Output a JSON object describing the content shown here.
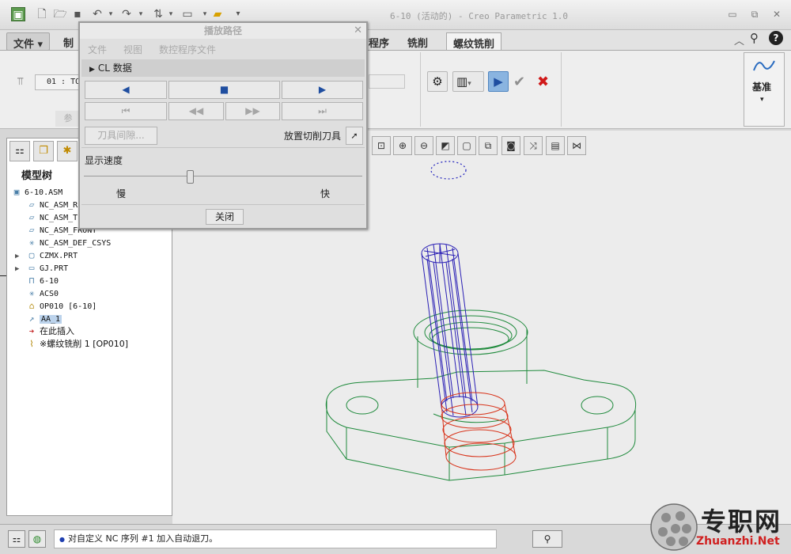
{
  "window": {
    "title": "6-10 (活动的) - Creo Parametric 1.0",
    "minimize": "▭",
    "restore": "⧉",
    "close": "✕"
  },
  "ribbon_tabs": {
    "file": "文件 ▾",
    "tab_partial": "制",
    "program": "程序",
    "milling": "铣削",
    "thread_milling": "螺纹铣削"
  },
  "ribbon": {
    "combo_value": "01 : TO",
    "ref_label": "参",
    "datum_label": "基准",
    "datum_arrow": "▾"
  },
  "left_panel": {
    "tab_icons": [
      "model-tree-icon",
      "layers-icon",
      "favorites-icon"
    ],
    "title": "模型树",
    "tree": [
      {
        "icon": "▣",
        "text": "6-10.ASM",
        "level": 0,
        "icon_name": "assembly-icon",
        "expand": ""
      },
      {
        "icon": "▱",
        "text": "NC_ASM_R",
        "level": 1,
        "icon_name": "datum-plane-icon",
        "expand": ""
      },
      {
        "icon": "▱",
        "text": "NC_ASM_T",
        "level": 1,
        "icon_name": "datum-plane-icon",
        "expand": ""
      },
      {
        "icon": "▱",
        "text": "NC_ASM_FRONT",
        "level": 1,
        "icon_name": "datum-plane-icon",
        "expand": ""
      },
      {
        "icon": "✳",
        "text": "NC_ASM_DEF_CSYS",
        "level": 1,
        "icon_name": "csys-icon",
        "expand": ""
      },
      {
        "icon": "▢",
        "text": "CZMX.PRT",
        "level": 1,
        "icon_name": "part-icon",
        "expand": "▶"
      },
      {
        "icon": "▭",
        "text": "GJ.PRT",
        "level": 1,
        "icon_name": "part-icon",
        "expand": "▶"
      },
      {
        "icon": "⊓",
        "text": "6-10",
        "level": 1,
        "icon_name": "workcell-icon",
        "expand": ""
      },
      {
        "icon": "✳",
        "text": "ACS0",
        "level": 1,
        "icon_name": "csys-icon",
        "expand": ""
      },
      {
        "icon": "⌂",
        "text": "OP010 [6-10]",
        "level": 1,
        "icon_name": "operation-icon",
        "expand": ""
      },
      {
        "icon": "↗",
        "text": "AA_1",
        "level": 1,
        "icon_name": "datum-axis-icon",
        "expand": ""
      },
      {
        "icon": "➔",
        "text": "在此插入",
        "level": 1,
        "icon_name": "insert-here-arrow-icon",
        "expand": ""
      },
      {
        "icon": "⌇",
        "text": "※螺纹铣削 1 [OP010]",
        "level": 1,
        "icon_name": "thread-milling-icon",
        "expand": ""
      }
    ]
  },
  "dialog": {
    "title": "播放路径",
    "close_glyph": "✕",
    "menu": [
      "文件",
      "视图",
      "数控程序文件"
    ],
    "cl_data_label": "CL 数据",
    "cl_expand": "▶",
    "play_buttons": {
      "rewind": "◀",
      "stop": "■",
      "play": "▶",
      "first": "⏮",
      "back": "◀◀",
      "forward": "▶▶",
      "last": "⏭"
    },
    "tool_clearance": "刀具间隙...",
    "place_cutter": "放置切削刀具",
    "speed_label": "显示速度",
    "slow_label": "慢",
    "fast_label": "快",
    "speed_level": 0.38,
    "close_button": "关闭"
  },
  "status_bar": {
    "message": "对自定义 NC 序列 #1 加入自动退刀。",
    "bullet": "●"
  },
  "watermark": {
    "text_cn": "专职网",
    "text_en": "Zhuanzhi.Net"
  },
  "colors": {
    "wire_green": "#1f8a3c",
    "wire_blue": "#2a1fb5",
    "wire_red": "#d8331a",
    "play_blue": "#1f4ea0",
    "cancel_red": "#d01919",
    "confirm_gray": "#8e8e8e"
  }
}
